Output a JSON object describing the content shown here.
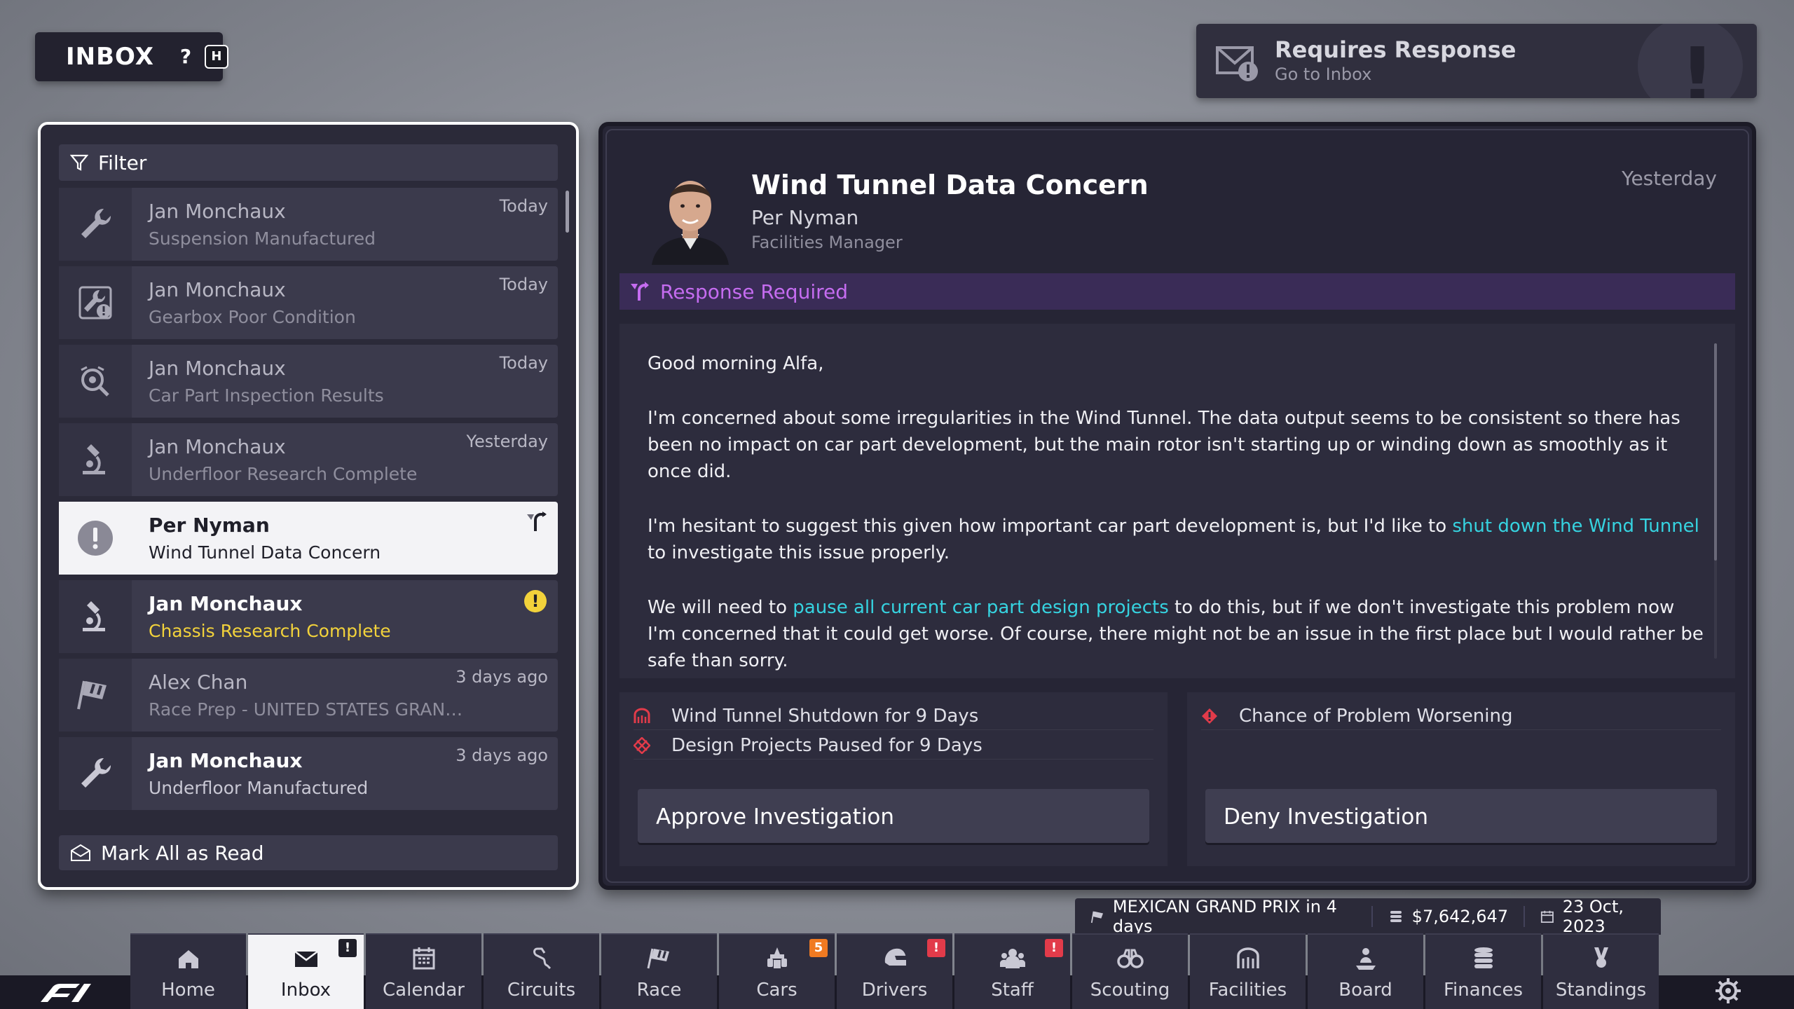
{
  "header": {
    "title": "INBOX",
    "help_label": "?",
    "help_key": "H"
  },
  "response_banner": {
    "title": "Requires Response",
    "subtitle": "Go to Inbox"
  },
  "list": {
    "filter_label": "Filter",
    "mark_all_label": "Mark All as Read",
    "messages": [
      {
        "sender": "Jan Monchaux",
        "subject": "Suspension Manufactured",
        "when": "Today",
        "icon": "wrench-icon"
      },
      {
        "sender": "Jan Monchaux",
        "subject": "Gearbox Poor Condition",
        "when": "Today",
        "icon": "wrench-warning-icon"
      },
      {
        "sender": "Jan Monchaux",
        "subject": "Car Part Inspection Results",
        "when": "Today",
        "icon": "inspection-icon"
      },
      {
        "sender": "Jan Monchaux",
        "subject": "Underfloor Research Complete",
        "when": "Yesterday",
        "icon": "microscope-icon"
      },
      {
        "sender": "Per Nyman",
        "subject": "Wind Tunnel Data Concern",
        "when": "",
        "icon": "exclamation-icon"
      },
      {
        "sender": "Jan Monchaux",
        "subject": "Chassis Research Complete",
        "when": "",
        "icon": "microscope-icon"
      },
      {
        "sender": "Alex Chan",
        "subject": "Race Prep - UNITED STATES GRAND ...",
        "when": "3 days ago",
        "icon": "race-flag-icon"
      },
      {
        "sender": "Jan Monchaux",
        "subject": "Underfloor Manufactured",
        "when": "3 days ago",
        "icon": "wrench-icon"
      }
    ]
  },
  "detail": {
    "title": "Wind Tunnel Data Concern",
    "from": "Per Nyman",
    "role": "Facilities Manager",
    "date": "Yesterday",
    "response_label": "Response Required",
    "greeting": "Good morning Alfa,",
    "p1": "I'm concerned about some irregularities in the Wind Tunnel. The data output seems to be consistent so there has been no impact on car part development, but the main rotor isn't starting up or winding down as smoothly as it once did.",
    "p2_a": "I'm hesitant to suggest this given how important car part development is, but I'd like to ",
    "p2_link": "shut down the Wind Tunnel",
    "p2_b": " to investigate this issue properly.",
    "p3_a": "We will need to ",
    "p3_link": "pause all current car part design projects",
    "p3_b": " to do this, but if we don't investigate this problem now I'm concerned that it could get worse. Of course, there might not be an issue in the first place but I would rather be safe than sorry.",
    "approve": {
      "effects": [
        "Wind Tunnel Shutdown for 9 Days",
        "Design Projects Paused for 9 Days"
      ],
      "button": "Approve Investigation"
    },
    "deny": {
      "effects": [
        "Chance of Problem Worsening"
      ],
      "button": "Deny Investigation"
    }
  },
  "status": {
    "event": "MEXICAN GRAND PRIX in 4 days",
    "money": "$7,642,647",
    "date": "23 Oct, 2023"
  },
  "nav": [
    {
      "label": "Home",
      "icon": "home-icon"
    },
    {
      "label": "Inbox",
      "icon": "envelope-icon",
      "badge": "!"
    },
    {
      "label": "Calendar",
      "icon": "calendar-icon"
    },
    {
      "label": "Circuits",
      "icon": "circuit-icon"
    },
    {
      "label": "Race",
      "icon": "race-flag-icon"
    },
    {
      "label": "Cars",
      "icon": "car-icon",
      "badge": "5"
    },
    {
      "label": "Drivers",
      "icon": "helmet-icon",
      "badge": "!"
    },
    {
      "label": "Staff",
      "icon": "staff-icon",
      "badge": "!"
    },
    {
      "label": "Scouting",
      "icon": "binoculars-icon"
    },
    {
      "label": "Facilities",
      "icon": "facilities-icon"
    },
    {
      "label": "Board",
      "icon": "board-icon"
    },
    {
      "label": "Finances",
      "icon": "coins-icon"
    },
    {
      "label": "Standings",
      "icon": "trophy-icon"
    }
  ],
  "colors": {
    "accent_red": "#e10600",
    "response_purple": "#c56cf0",
    "link_cyan": "#36d3e0",
    "unread_yellow": "#f2d23b",
    "badge_red": "#e23b4a",
    "badge_orange": "#f07a22"
  }
}
